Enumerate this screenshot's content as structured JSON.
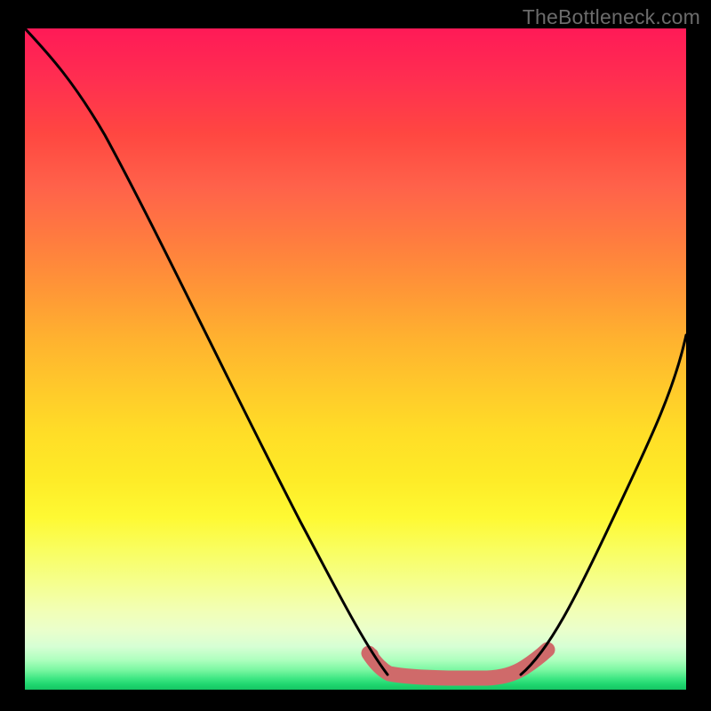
{
  "watermark": "TheBottleneck.com",
  "chart_data": {
    "type": "line",
    "title": "",
    "xlabel": "",
    "ylabel": "",
    "xlim": [
      0,
      100
    ],
    "ylim": [
      0,
      100
    ],
    "gradient_stops": [
      {
        "pos": 0,
        "color": "#ff1a57"
      },
      {
        "pos": 8,
        "color": "#ff2f50"
      },
      {
        "pos": 16,
        "color": "#ff4741"
      },
      {
        "pos": 24,
        "color": "#ff624a"
      },
      {
        "pos": 32,
        "color": "#ff7c3f"
      },
      {
        "pos": 40,
        "color": "#ff9836"
      },
      {
        "pos": 47,
        "color": "#ffb22f"
      },
      {
        "pos": 54,
        "color": "#ffc82b"
      },
      {
        "pos": 61,
        "color": "#ffdd27"
      },
      {
        "pos": 68,
        "color": "#feeb27"
      },
      {
        "pos": 74,
        "color": "#fef933"
      },
      {
        "pos": 79,
        "color": "#f9fe61"
      },
      {
        "pos": 84,
        "color": "#f5ff8f"
      },
      {
        "pos": 88,
        "color": "#f2ffb5"
      },
      {
        "pos": 91,
        "color": "#eaffcb"
      },
      {
        "pos": 93.5,
        "color": "#d6ffd4"
      },
      {
        "pos": 95.5,
        "color": "#aeffbe"
      },
      {
        "pos": 97,
        "color": "#7bf7a2"
      },
      {
        "pos": 98.3,
        "color": "#3fe783"
      },
      {
        "pos": 99.2,
        "color": "#1fd66f"
      },
      {
        "pos": 100,
        "color": "#16c564"
      }
    ],
    "series": [
      {
        "name": "left-curve",
        "color": "#000000",
        "points": [
          {
            "x": 0,
            "y": 100
          },
          {
            "x": 7,
            "y": 93
          },
          {
            "x": 18,
            "y": 75
          },
          {
            "x": 30,
            "y": 52
          },
          {
            "x": 40,
            "y": 30
          },
          {
            "x": 48,
            "y": 12
          },
          {
            "x": 52,
            "y": 5
          },
          {
            "x": 55,
            "y": 2.5
          }
        ]
      },
      {
        "name": "right-curve",
        "color": "#000000",
        "points": [
          {
            "x": 75,
            "y": 2.5
          },
          {
            "x": 80,
            "y": 8
          },
          {
            "x": 86,
            "y": 20
          },
          {
            "x": 92,
            "y": 34
          },
          {
            "x": 100,
            "y": 54
          }
        ]
      },
      {
        "name": "optimal-band",
        "color": "#d06868",
        "stroke_width": 14,
        "points": [
          {
            "x": 52,
            "y": 5.5
          },
          {
            "x": 54,
            "y": 3.2
          },
          {
            "x": 57,
            "y": 2.2
          },
          {
            "x": 64,
            "y": 1.9
          },
          {
            "x": 70,
            "y": 1.9
          },
          {
            "x": 73,
            "y": 2.2
          },
          {
            "x": 76,
            "y": 3.6
          },
          {
            "x": 79,
            "y": 6.0
          }
        ]
      }
    ],
    "optimal_dots": [
      {
        "x": 52.5,
        "y": 5.2
      },
      {
        "x": 54.0,
        "y": 3.4
      }
    ]
  }
}
